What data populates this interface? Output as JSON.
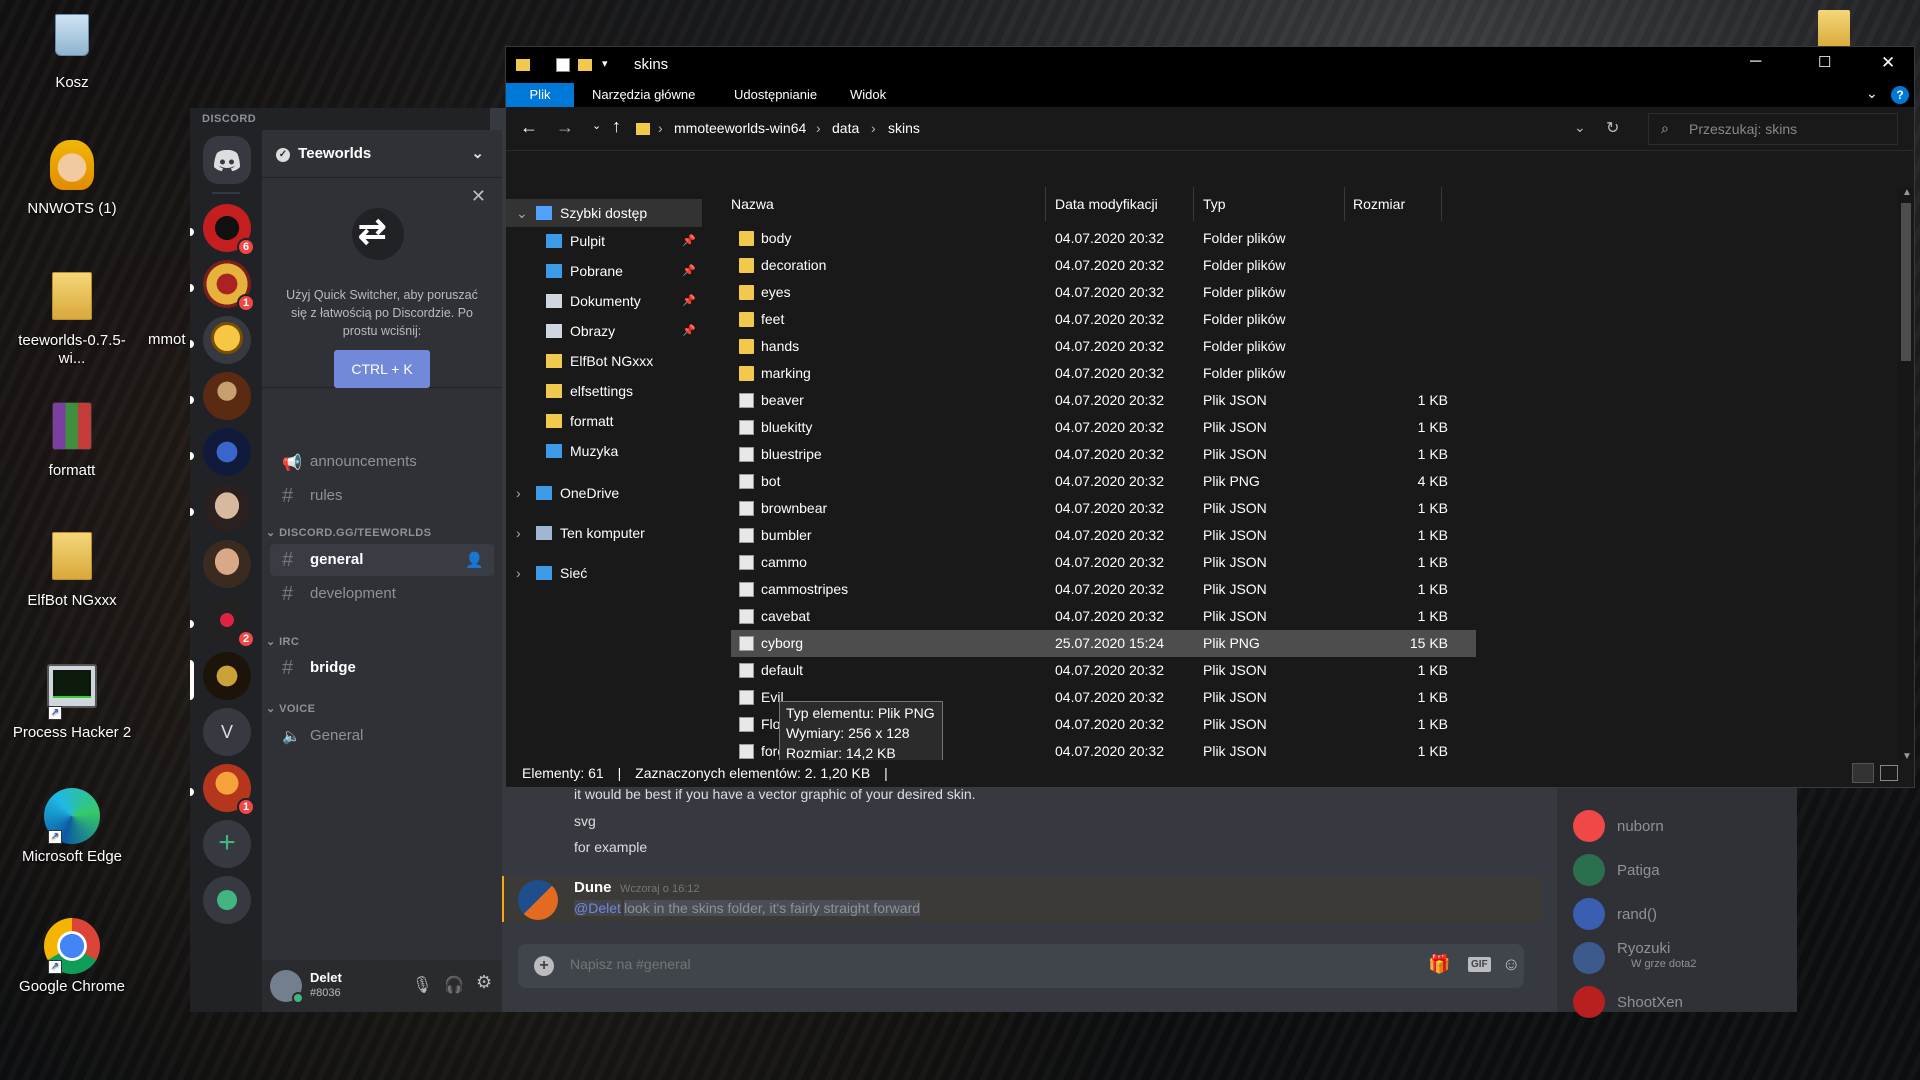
{
  "desktop": {
    "icons": [
      {
        "label": "Kosz"
      },
      {
        "label": "NNWOTS (1)"
      },
      {
        "label": "teeworlds-0.7.5-wi..."
      },
      {
        "label": "mmot"
      },
      {
        "label": "formatt"
      },
      {
        "label": "ElfBot NGxxx"
      },
      {
        "label": "Process Hacker 2"
      },
      {
        "label": "Microsoft Edge"
      },
      {
        "label": "Google Chrome"
      }
    ]
  },
  "discord": {
    "brand": "DISCORD",
    "server_name": "Teeworlds",
    "quick_switcher": {
      "text": "Użyj Quick Switcher, aby poruszać się z łatwością po Discordzie. Po prostu wciśnij:",
      "shortcut": "CTRL + K"
    },
    "guild_badges": [
      "6",
      "1",
      "2",
      "1"
    ],
    "guild_letters": [
      "V"
    ],
    "channels_top": [
      {
        "name": "announcements",
        "icon": "megaphone-icon"
      },
      {
        "name": "rules",
        "icon": "hash-icon"
      }
    ],
    "categories": [
      "DISCORD.GG/TEEWORLDS",
      "IRC",
      "VOICE"
    ],
    "channels_main": [
      {
        "name": "general"
      },
      {
        "name": "development"
      }
    ],
    "channels_irc": [
      {
        "name": "bridge"
      }
    ],
    "channels_voice": [
      {
        "name": "General"
      }
    ],
    "user": {
      "name": "Delet",
      "tag": "#8036"
    },
    "messages": [
      {
        "text": "it would be best if you have a vector graphic of your desired skin."
      },
      {
        "text": "svg"
      },
      {
        "text": "for example"
      }
    ],
    "reply": {
      "author": "Dune",
      "timestamp": "Wczoraj o 16:12",
      "mention": "@Delet",
      "text": "look in the skins folder, it's fairly straight forward"
    },
    "composer_placeholder": "Napisz na #general",
    "members": [
      {
        "name": "nuborn",
        "status": ""
      },
      {
        "name": "Patiga",
        "status": ""
      },
      {
        "name": "rand()",
        "status": ""
      },
      {
        "name": "Ryozuki",
        "status": "W grze dota2"
      },
      {
        "name": "ShootXen",
        "status": ""
      }
    ]
  },
  "explorer": {
    "title": "skins",
    "ribbon_tabs": [
      "Plik",
      "Narzędzia główne",
      "Udostępnianie",
      "Widok"
    ],
    "breadcrumb": [
      "mmoteeworlds-win64",
      "data",
      "skins"
    ],
    "search_placeholder": "Przeszukaj: skins",
    "columns": [
      "Nazwa",
      "Data modyfikacji",
      "Typ",
      "Rozmiar"
    ],
    "nav": [
      {
        "label": "Szybki dostęp",
        "pinned": false
      },
      {
        "label": "Pulpit",
        "pinned": true
      },
      {
        "label": "Pobrane",
        "pinned": true
      },
      {
        "label": "Dokumenty",
        "pinned": true
      },
      {
        "label": "Obrazy",
        "pinned": true
      },
      {
        "label": "ElfBot NGxxx",
        "pinned": false
      },
      {
        "label": "elfsettings",
        "pinned": false
      },
      {
        "label": "formatt",
        "pinned": false
      },
      {
        "label": "Muzyka",
        "pinned": false
      },
      {
        "label": "OneDrive",
        "pinned": false
      },
      {
        "label": "Ten komputer",
        "pinned": false
      },
      {
        "label": "Sieć",
        "pinned": false
      }
    ],
    "files": [
      {
        "name": "body",
        "date": "04.07.2020 20:32",
        "type": "Folder plików",
        "size": ""
      },
      {
        "name": "decoration",
        "date": "04.07.2020 20:32",
        "type": "Folder plików",
        "size": ""
      },
      {
        "name": "eyes",
        "date": "04.07.2020 20:32",
        "type": "Folder plików",
        "size": ""
      },
      {
        "name": "feet",
        "date": "04.07.2020 20:32",
        "type": "Folder plików",
        "size": ""
      },
      {
        "name": "hands",
        "date": "04.07.2020 20:32",
        "type": "Folder plików",
        "size": ""
      },
      {
        "name": "marking",
        "date": "04.07.2020 20:32",
        "type": "Folder plików",
        "size": ""
      },
      {
        "name": "beaver",
        "date": "04.07.2020 20:32",
        "type": "Plik JSON",
        "size": "1 KB"
      },
      {
        "name": "bluekitty",
        "date": "04.07.2020 20:32",
        "type": "Plik JSON",
        "size": "1 KB"
      },
      {
        "name": "bluestripe",
        "date": "04.07.2020 20:32",
        "type": "Plik JSON",
        "size": "1 KB"
      },
      {
        "name": "bot",
        "date": "04.07.2020 20:32",
        "type": "Plik PNG",
        "size": "4 KB"
      },
      {
        "name": "brownbear",
        "date": "04.07.2020 20:32",
        "type": "Plik JSON",
        "size": "1 KB"
      },
      {
        "name": "bumbler",
        "date": "04.07.2020 20:32",
        "type": "Plik JSON",
        "size": "1 KB"
      },
      {
        "name": "cammo",
        "date": "04.07.2020 20:32",
        "type": "Plik JSON",
        "size": "1 KB"
      },
      {
        "name": "cammostripes",
        "date": "04.07.2020 20:32",
        "type": "Plik JSON",
        "size": "1 KB"
      },
      {
        "name": "cavebat",
        "date": "04.07.2020 20:32",
        "type": "Plik JSON",
        "size": "1 KB"
      },
      {
        "name": "cyborg",
        "date": "25.07.2020 15:24",
        "type": "Plik PNG",
        "size": "15 KB"
      },
      {
        "name": "default",
        "date": "04.07.2020 20:32",
        "type": "Plik JSON",
        "size": "1 KB"
      },
      {
        "name": "Evil",
        "date": "04.07.2020 20:32",
        "type": "Plik JSON",
        "size": "1 KB"
      },
      {
        "name": "Flo",
        "date": "04.07.2020 20:32",
        "type": "Plik JSON",
        "size": "1 KB"
      },
      {
        "name": "force",
        "date": "04.07.2020 20:32",
        "type": "Plik JSON",
        "size": "1 KB"
      }
    ],
    "tooltip": [
      "Typ elementu: Plik PNG",
      "Wymiary: 256 x 128",
      "Rozmiar: 14,2 KB"
    ],
    "status": {
      "count": "Elementy: 61",
      "selection": "Zaznaczonych elementów: 2. 1,20 KB"
    }
  },
  "colors": {
    "discord_accent": "#7289da",
    "explorer_accent": "#0078d7",
    "mention": "#7289da"
  }
}
